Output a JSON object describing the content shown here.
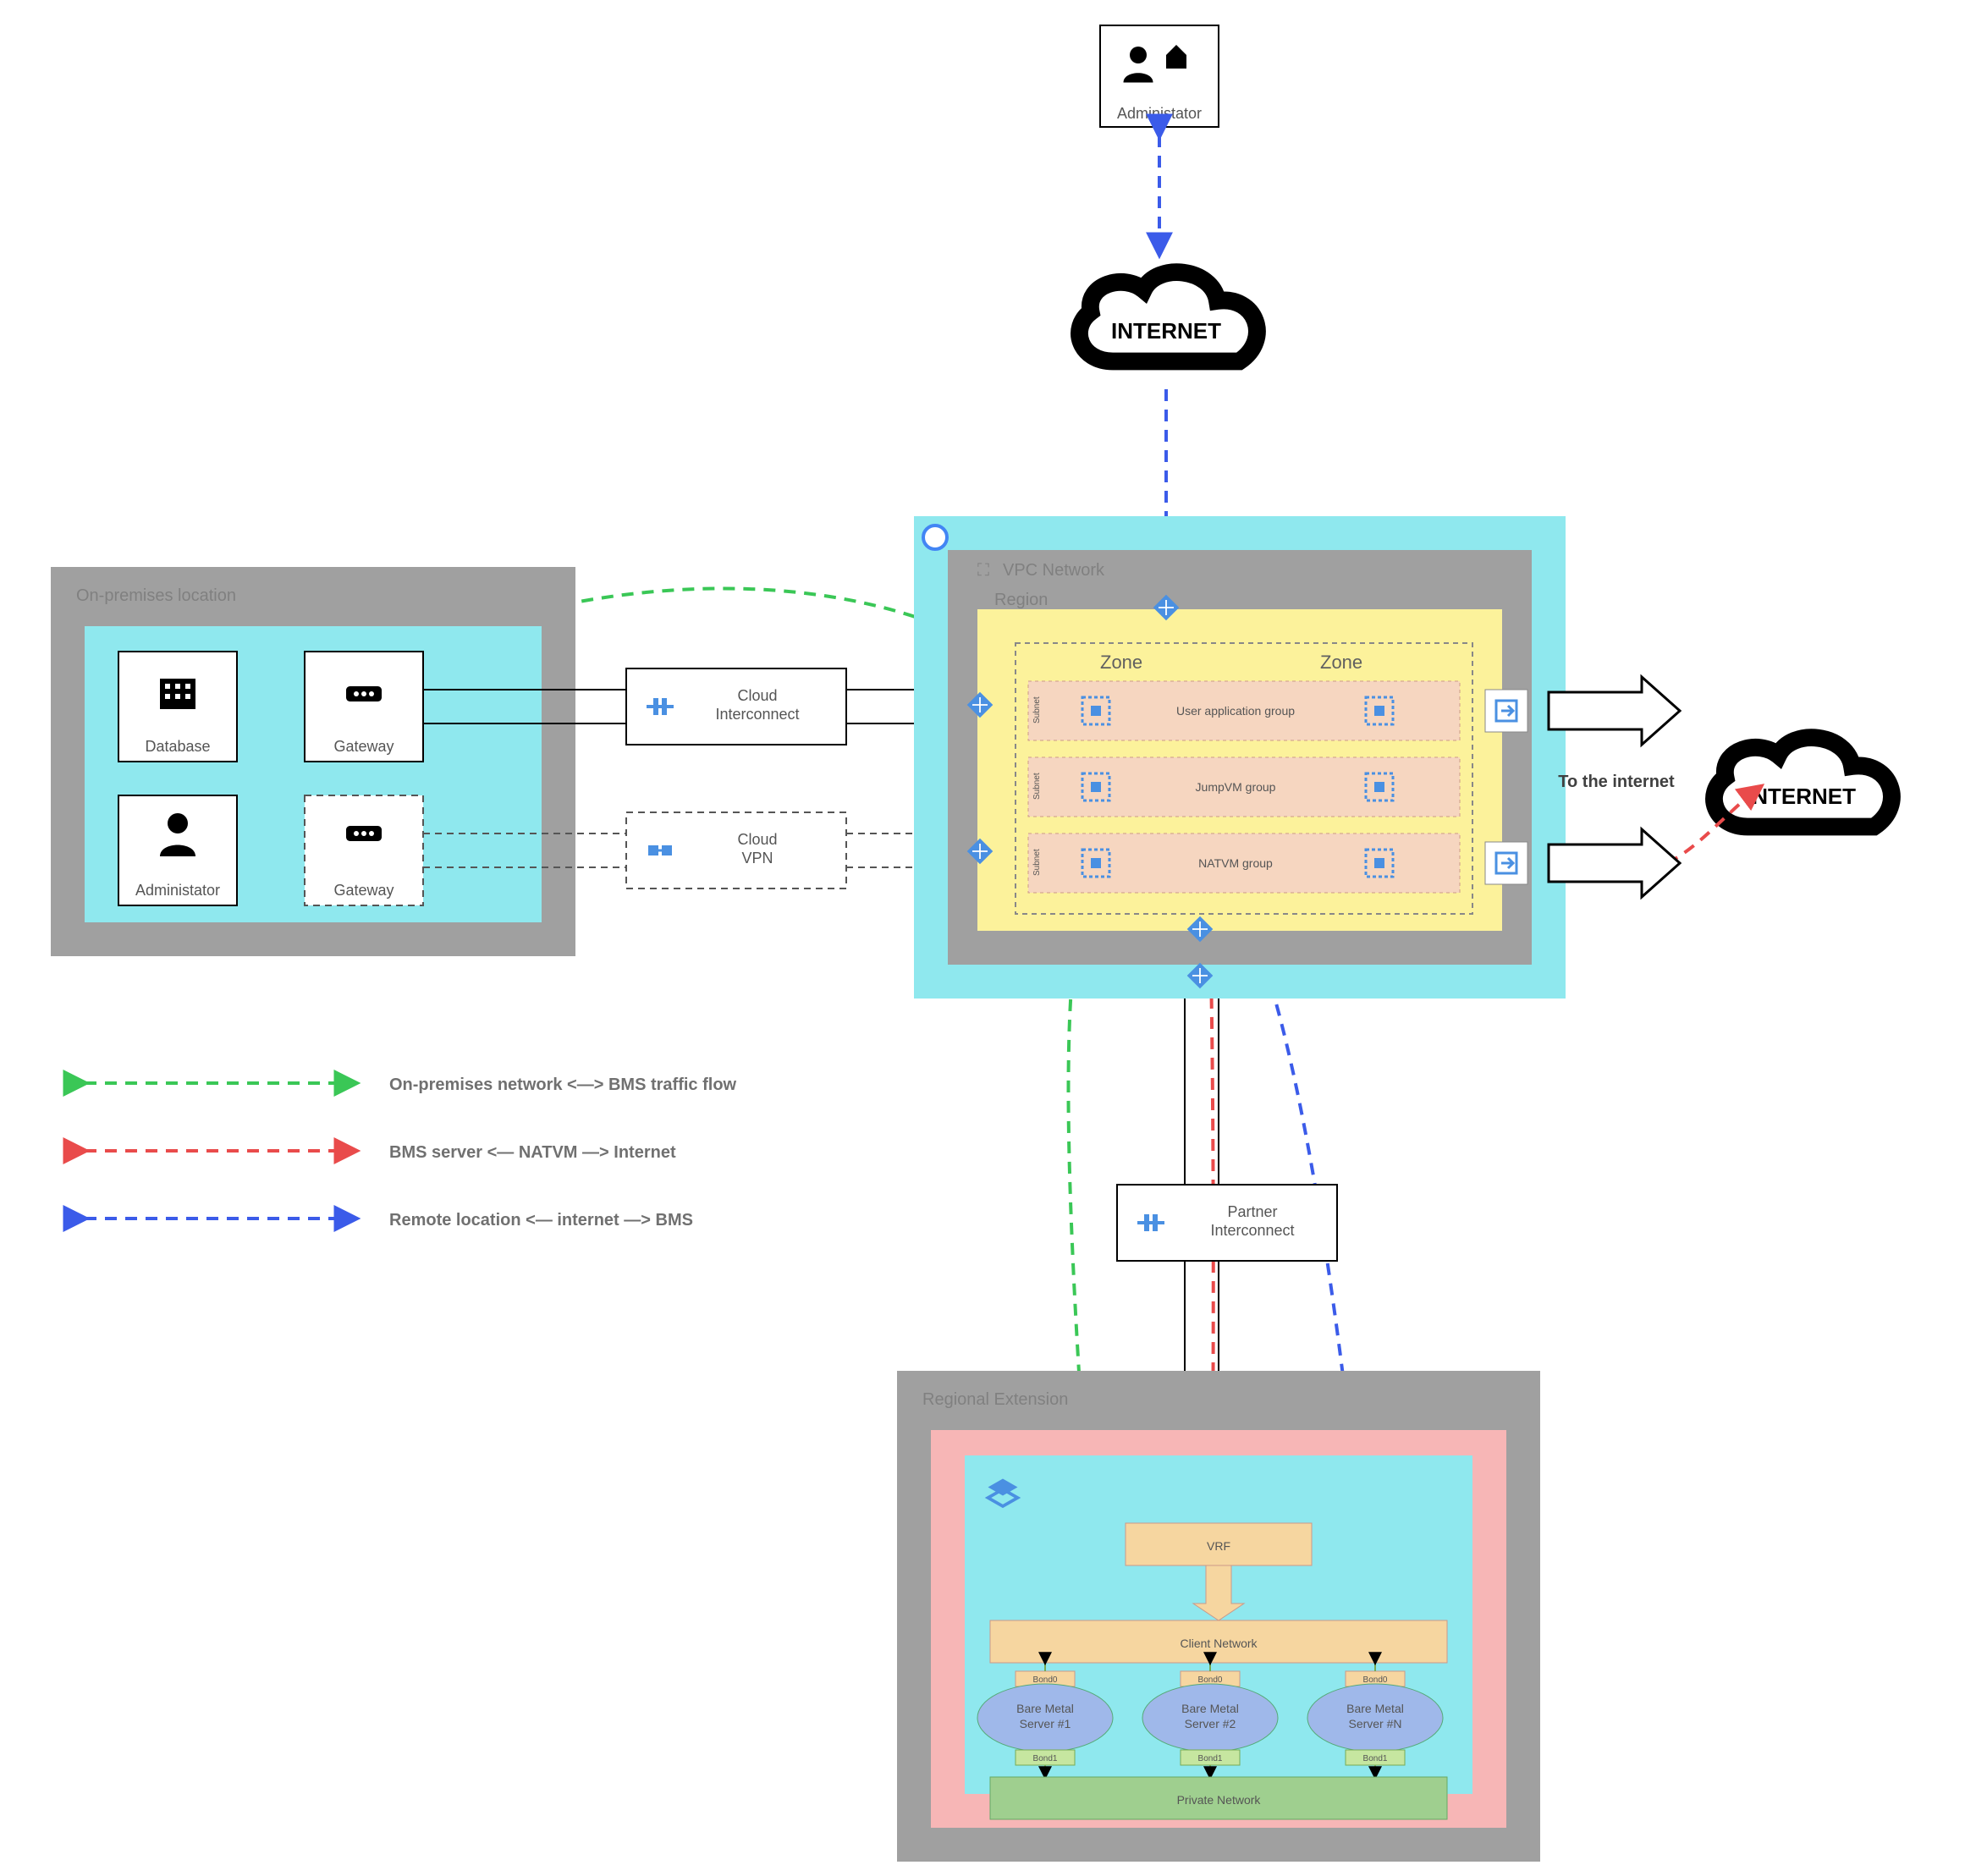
{
  "admin_top": "Administator",
  "internet_top": "INTERNET",
  "internet_right": "INTERNET",
  "to_internet": "To the internet",
  "onprem": {
    "title": "On-premises location",
    "database": "Database",
    "gateway1": "Gateway",
    "admin": "Administator",
    "gateway2": "Gateway"
  },
  "cloud_interconnect": "Cloud\nInterconnect",
  "cloud_vpn": "Cloud\nVPN",
  "vpc": {
    "title": "VPC Network",
    "region": "Region",
    "zone": "Zone",
    "subnet": "Subnet",
    "user_app": "User application group",
    "jump": "JumpVM group",
    "nat": "NATVM group"
  },
  "partner_interconnect": "Partner\nInterconnect",
  "regional": {
    "title": "Regional Extension",
    "vrf": "VRF",
    "client_net": "Client Network",
    "bms1": "Bare Metal\nServer #1",
    "bms2": "Bare Metal\nServer #2",
    "bmsN": "Bare Metal\nServer #N",
    "bond0": "Bond0",
    "bond1": "Bond1",
    "private_net": "Private Network"
  },
  "legend": {
    "onprem_bms": "On-premises network <—> BMS traffic flow",
    "bms_nat": "BMS server   <— NATVM —>   Internet",
    "remote_bms": "Remote location   <— internet —>   BMS"
  }
}
